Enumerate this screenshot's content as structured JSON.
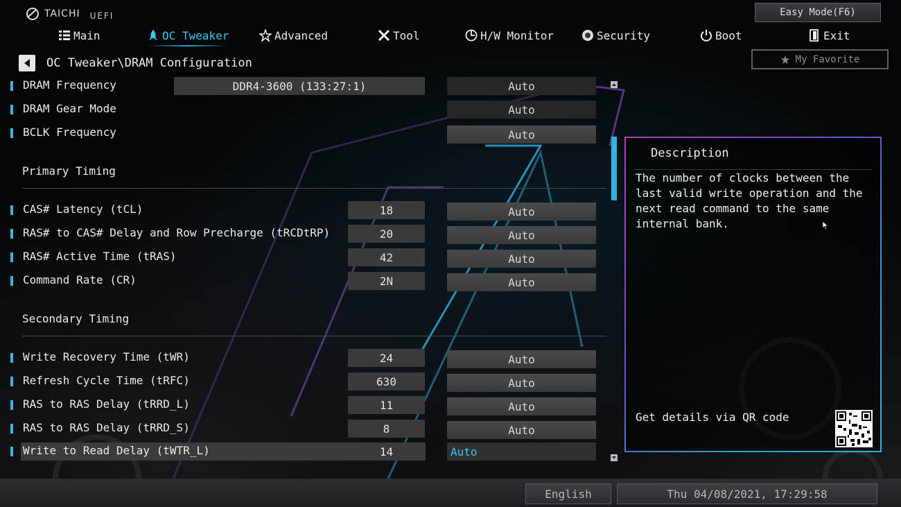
{
  "brand": {
    "name": "TAICHI",
    "sub": "UEFI"
  },
  "easy_mode_label": "Easy Mode(F6)",
  "my_favorite_label": "My Favorite",
  "nav": [
    {
      "label": "Main",
      "icon": "list-icon"
    },
    {
      "label": "OC Tweaker",
      "icon": "rocket-icon",
      "active": true
    },
    {
      "label": "Advanced",
      "icon": "star-icon"
    },
    {
      "label": "Tool",
      "icon": "tools-icon"
    },
    {
      "label": "H/W Monitor",
      "icon": "monitor-icon"
    },
    {
      "label": "Security",
      "icon": "shield-icon"
    },
    {
      "label": "Boot",
      "icon": "power-icon"
    },
    {
      "label": "Exit",
      "icon": "exit-icon"
    }
  ],
  "breadcrumb": "OC Tweaker\\DRAM Configuration",
  "settings_top": [
    {
      "label": "DRAM Frequency",
      "value": "DDR4-3600 (133:27:1)",
      "option": "Auto"
    },
    {
      "label": "DRAM Gear Mode",
      "value": "",
      "option": "Auto"
    },
    {
      "label": "BCLK Frequency",
      "value": "",
      "option": "Auto"
    }
  ],
  "primary_timing": {
    "title": "Primary Timing",
    "rows": [
      {
        "label": "CAS# Latency (tCL)",
        "value": "18",
        "option": "Auto"
      },
      {
        "label": "RAS# to CAS# Delay and Row Precharge (tRCDtRP)",
        "value": "20",
        "option": "Auto"
      },
      {
        "label": "RAS# Active Time (tRAS)",
        "value": "42",
        "option": "Auto"
      },
      {
        "label": "Command Rate (CR)",
        "value": "2N",
        "option": "Auto"
      }
    ]
  },
  "secondary_timing": {
    "title": "Secondary Timing",
    "rows": [
      {
        "label": "Write Recovery Time (tWR)",
        "value": "24",
        "option": "Auto"
      },
      {
        "label": "Refresh Cycle Time (tRFC)",
        "value": "630",
        "option": "Auto"
      },
      {
        "label": "RAS to RAS Delay (tRRD_L)",
        "value": "11",
        "option": "Auto"
      },
      {
        "label": "RAS to RAS Delay (tRRD_S)",
        "value": "8",
        "option": "Auto"
      },
      {
        "label": "Write to Read Delay (tWTR_L)",
        "value": "14",
        "option": "Auto",
        "selected": true
      }
    ]
  },
  "description": {
    "title": "Description",
    "text": "The number of clocks between the last valid write operation and the next read command to the same internal bank.",
    "qr_label": "Get details via QR code"
  },
  "footer": {
    "language": "English",
    "datetime": "Thu 04/08/2021, 17:29:58"
  },
  "colors": {
    "accent": "#39c6ee",
    "panel": "#3a3a3a",
    "frame_pink": "#b03fb8"
  }
}
